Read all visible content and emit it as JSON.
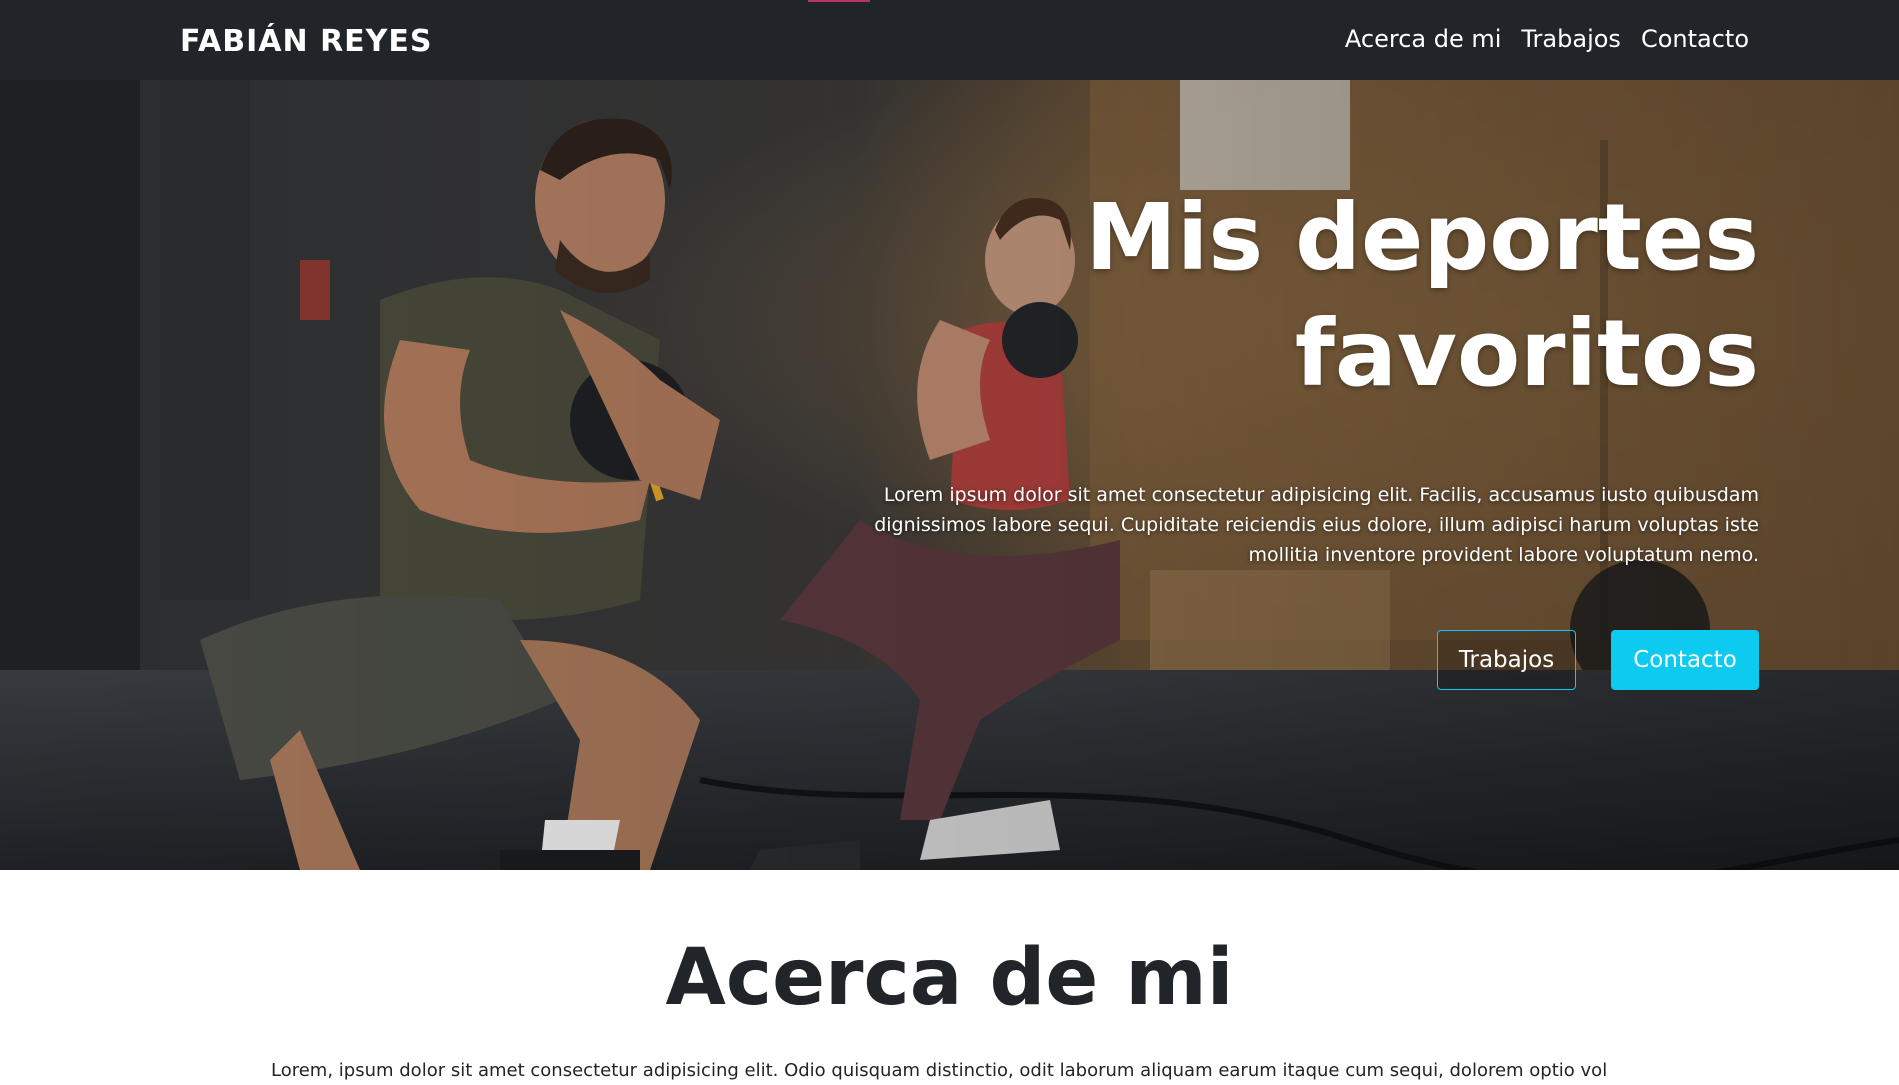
{
  "navbar": {
    "brand": "FABIÁN REYES",
    "links": [
      {
        "label": "Acerca de mi"
      },
      {
        "label": "Trabajos"
      },
      {
        "label": "Contacto"
      }
    ]
  },
  "hero": {
    "title_line1": "Mis deportes",
    "title_line2": "favoritos",
    "text": "Lorem ipsum dolor sit amet consectetur adipisicing elit. Facilis, accusamus iusto quibusdam dignissimos labore sequi. Cupiditate reiciendis eius dolore, illum adipisci harum voluptas iste mollitia inventore provident labore voluptatum nemo.",
    "buttons": {
      "secondary": "Trabajos",
      "primary": "Contacto"
    },
    "image": "gym-kettlebell-squat-photo"
  },
  "about": {
    "title": "Acerca de mi",
    "text": "Lorem, ipsum dolor sit amet consectetur adipisicing elit. Odio quisquam distinctio, odit laborum aliquam earum itaque cum sequi, dolorem optio vol"
  },
  "colors": {
    "navbar_bg": "#212529",
    "accent": "#0dcaf0",
    "nav_indicator": "#b5365f",
    "text_dark": "#212529"
  }
}
